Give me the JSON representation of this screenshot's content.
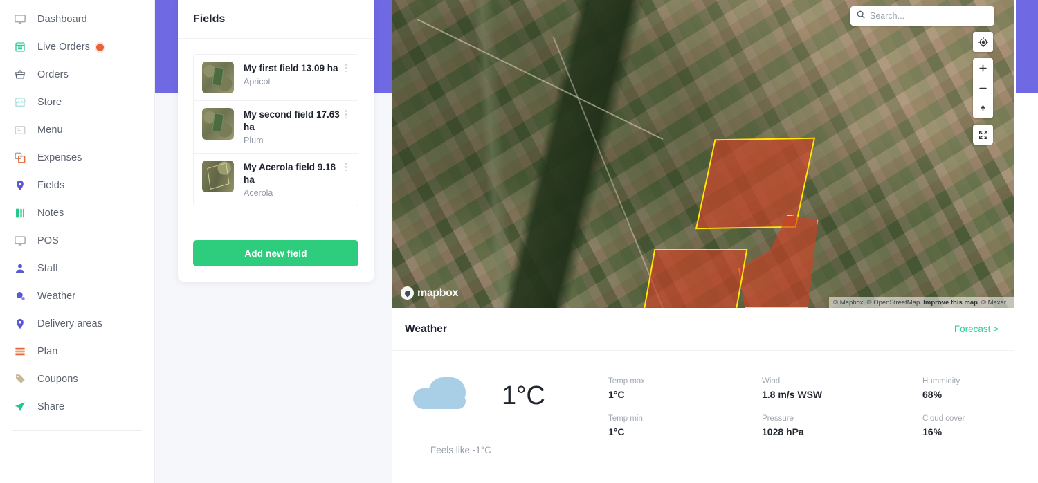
{
  "sidebar": {
    "items": [
      {
        "label": "Dashboard",
        "icon": "monitor-icon",
        "badge": false
      },
      {
        "label": "Live Orders",
        "icon": "receipt-icon",
        "badge": true
      },
      {
        "label": "Orders",
        "icon": "basket-icon",
        "badge": false
      },
      {
        "label": "Store",
        "icon": "store-icon",
        "badge": false
      },
      {
        "label": "Menu",
        "icon": "menu-card-icon",
        "badge": false
      },
      {
        "label": "Expenses",
        "icon": "expenses-icon",
        "badge": false
      },
      {
        "label": "Fields",
        "icon": "pin-icon",
        "badge": false
      },
      {
        "label": "Notes",
        "icon": "notes-icon",
        "badge": false
      },
      {
        "label": "POS",
        "icon": "monitor-icon",
        "badge": false
      },
      {
        "label": "Staff",
        "icon": "user-icon",
        "badge": false
      },
      {
        "label": "Weather",
        "icon": "weather-icon",
        "badge": false
      },
      {
        "label": "Delivery areas",
        "icon": "pin-icon",
        "badge": false
      },
      {
        "label": "Plan",
        "icon": "plan-icon",
        "badge": false
      },
      {
        "label": "Coupons",
        "icon": "tag-icon",
        "badge": false
      },
      {
        "label": "Share",
        "icon": "share-icon",
        "badge": false
      }
    ]
  },
  "fields_panel": {
    "title": "Fields",
    "add_button_label": "Add new field",
    "items": [
      {
        "title": "My first field 13.09 ha",
        "crop": "Apricot",
        "thumb": "satellite-thumb-a"
      },
      {
        "title": "My second field 17.63 ha",
        "crop": "Plum",
        "thumb": "satellite-thumb-a"
      },
      {
        "title": "My Acerola field 9.18 ha",
        "crop": "Acerola",
        "thumb": "satellite-thumb-b"
      }
    ]
  },
  "map": {
    "search_placeholder": "Search...",
    "search_value": "",
    "logo_text": "mapbox",
    "attribution": {
      "mapbox": "© Mapbox",
      "osm": "© OpenStreetMap",
      "improve": "Improve this map",
      "maxar": "© Maxar"
    },
    "controls": [
      {
        "name": "geolocate-button",
        "glyph": "locate"
      },
      {
        "name": "zoom-in-button",
        "glyph": "plus"
      },
      {
        "name": "zoom-out-button",
        "glyph": "minus"
      },
      {
        "name": "compass-button",
        "glyph": "compass"
      },
      {
        "name": "fullscreen-button",
        "glyph": "expand"
      }
    ],
    "field_outline_color": "#ffe800",
    "field_fill_color": "#ce4226"
  },
  "weather": {
    "title": "Weather",
    "forecast_link": "Forecast >",
    "condition_icon": "cloud-icon",
    "temperature": "1°C",
    "feels_like": "Feels like -1°C",
    "metrics": [
      {
        "label": "Temp max",
        "value": "1°C"
      },
      {
        "label": "Wind",
        "value": "1.8 m/s WSW"
      },
      {
        "label": "Hummidity",
        "value": "68%"
      },
      {
        "label": "Temp min",
        "value": "1°C"
      },
      {
        "label": "Pressure",
        "value": "1028 hPa"
      },
      {
        "label": "Cloud cover",
        "value": "16%"
      }
    ]
  },
  "theme": {
    "accent_purple": "#6f6ae4",
    "accent_green": "#2ecd7e",
    "link_green": "#2ecd9c",
    "badge_orange": "#e8633a"
  }
}
